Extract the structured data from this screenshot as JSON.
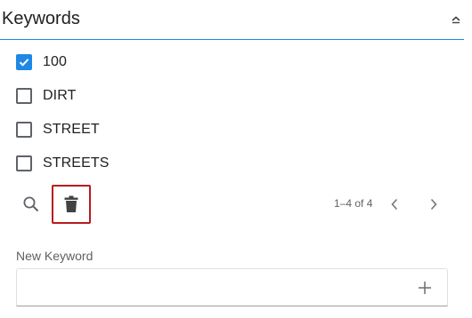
{
  "section": {
    "title": "Keywords",
    "collapse_icon": "chevron-up-icon"
  },
  "keywords": [
    {
      "label": "100",
      "checked": true
    },
    {
      "label": "DIRT",
      "checked": false
    },
    {
      "label": "STREET",
      "checked": false
    },
    {
      "label": "STREETS",
      "checked": false
    }
  ],
  "toolbar": {
    "search_icon": "search-icon",
    "delete_icon": "trash-icon",
    "pagination": "1–4 of 4",
    "prev_icon": "chevron-left-icon",
    "next_icon": "chevron-right-icon"
  },
  "new_keyword": {
    "label": "New Keyword",
    "value": "",
    "placeholder": "",
    "add_icon": "plus-icon"
  },
  "colors": {
    "accent": "#1e88e5",
    "delete_highlight": "#b71c1c",
    "icon": "#5f6368"
  }
}
